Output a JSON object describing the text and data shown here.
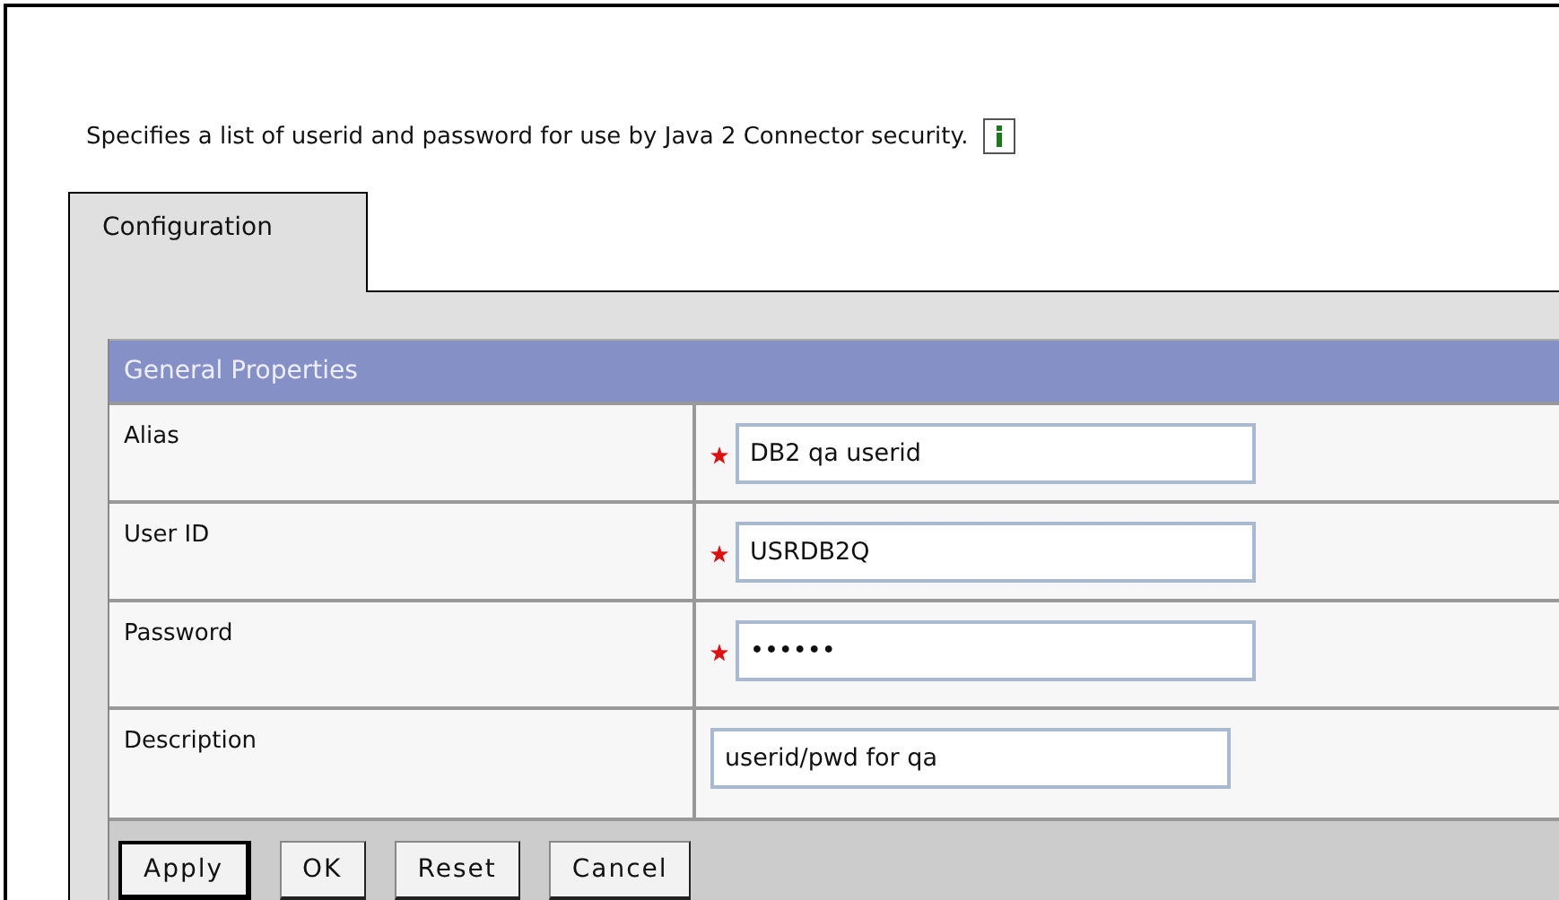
{
  "description": "Specifies a list of userid and password for use by Java 2 Connector security.",
  "tabs": [
    {
      "label": "Configuration",
      "selected": true
    }
  ],
  "section": {
    "title": "General Properties"
  },
  "fields": [
    {
      "label": "Alias",
      "value": "DB2 qa userid",
      "required": true
    },
    {
      "label": "User ID",
      "value": "USRDB2Q",
      "required": true
    },
    {
      "label": "Password",
      "value": "••••••",
      "required": true
    },
    {
      "label": "Description",
      "value": "userid/pwd for qa",
      "required": false
    }
  ],
  "buttons": [
    {
      "label": "Apply",
      "default": true
    },
    {
      "label": "OK",
      "default": false
    },
    {
      "label": "Reset",
      "default": false
    },
    {
      "label": "Cancel",
      "default": false
    }
  ]
}
